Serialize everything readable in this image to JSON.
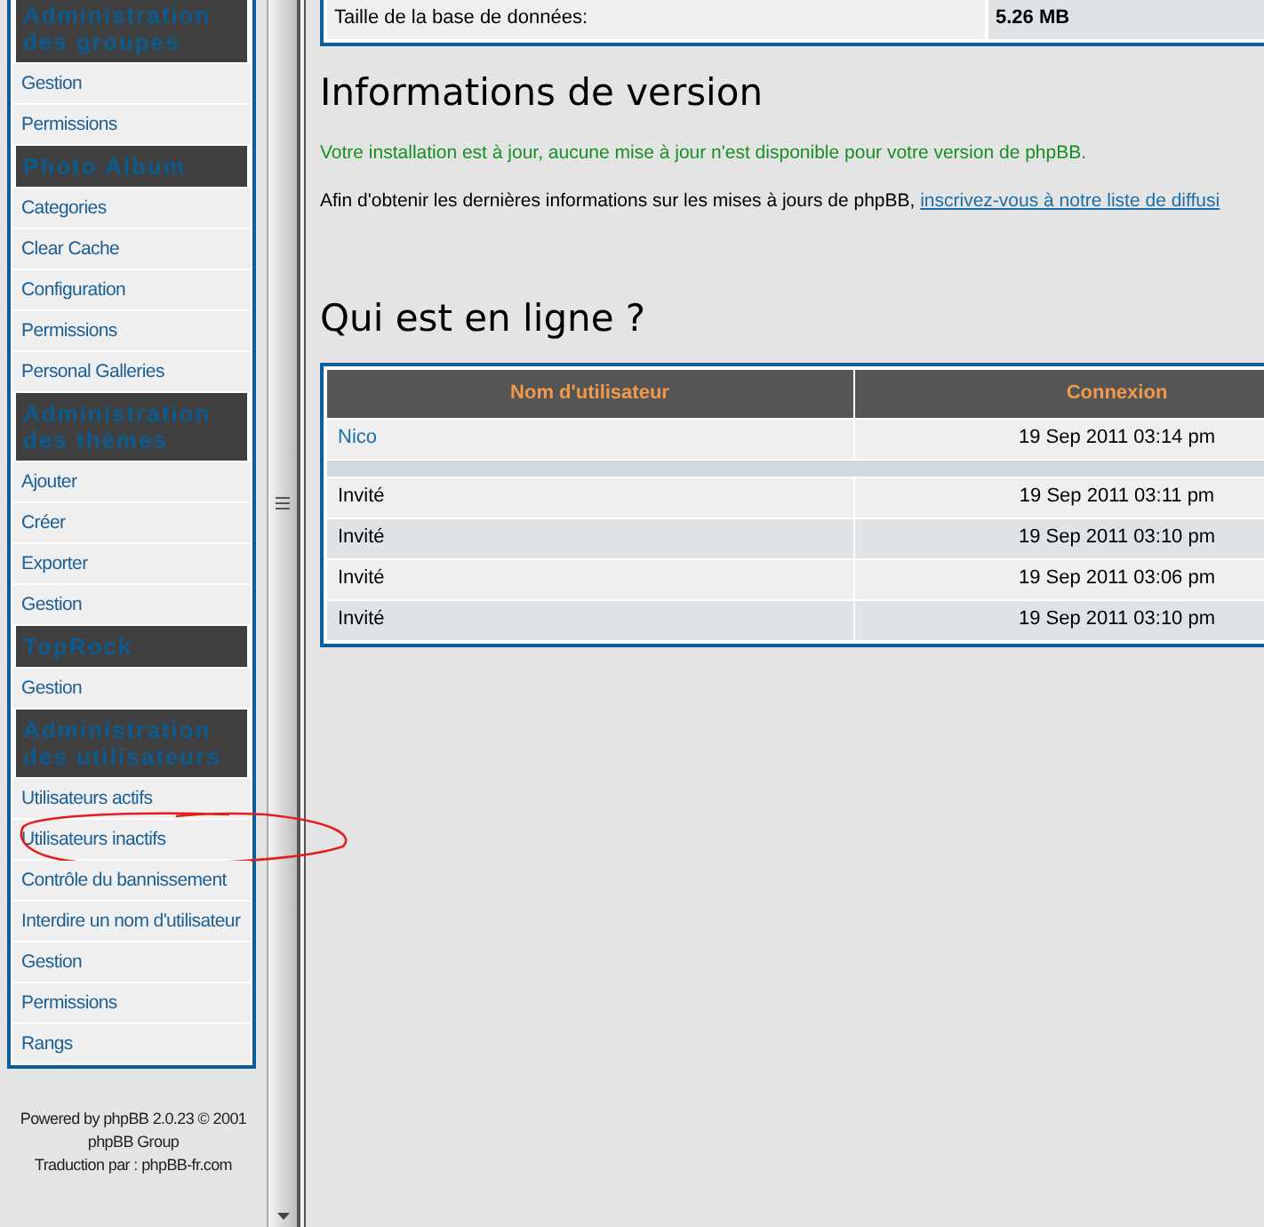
{
  "sidebar": {
    "sections": [
      {
        "title": "Administration des groupes",
        "items": [
          {
            "label": "Gestion",
            "highlighted": false
          },
          {
            "label": "Permissions",
            "highlighted": false
          }
        ]
      },
      {
        "title": "Photo Album",
        "items": [
          {
            "label": "Categories",
            "highlighted": false
          },
          {
            "label": "Clear Cache",
            "highlighted": false
          },
          {
            "label": "Configuration",
            "highlighted": false
          },
          {
            "label": "Permissions",
            "highlighted": false
          },
          {
            "label": "Personal Galleries",
            "highlighted": false
          }
        ]
      },
      {
        "title": "Administration des thèmes",
        "items": [
          {
            "label": "Ajouter",
            "highlighted": false
          },
          {
            "label": "Créer",
            "highlighted": false
          },
          {
            "label": "Exporter",
            "highlighted": false
          },
          {
            "label": "Gestion",
            "highlighted": false
          }
        ]
      },
      {
        "title": "TopRock",
        "items": [
          {
            "label": "Gestion",
            "highlighted": false
          }
        ]
      },
      {
        "title": "Administration des utilisateurs",
        "items": [
          {
            "label": "Utilisateurs actifs",
            "highlighted": false
          },
          {
            "label": "Utilisateurs inactifs",
            "highlighted": true
          },
          {
            "label": "Contrôle du bannissement",
            "highlighted": false
          },
          {
            "label": "Interdire un nom d'utilisateur",
            "highlighted": false
          },
          {
            "label": "Gestion",
            "highlighted": false
          },
          {
            "label": "Permissions",
            "highlighted": false
          },
          {
            "label": "Rangs",
            "highlighted": false
          }
        ]
      }
    ],
    "footer": [
      "Powered by phpBB 2.0.23 © 2001",
      "phpBB Group",
      "Traduction par : phpBB-fr.com"
    ]
  },
  "stats_row": {
    "label": "Taille de la base de données:",
    "value": "5.26 MB"
  },
  "version": {
    "title": "Informations de version",
    "status": "Votre installation est à jour, aucune mise à jour n'est disponible pour votre version de phpBB.",
    "info": "Afin d'obtenir les dernières informations sur les mises à jours de phpBB,",
    "link": "inscrivez-vous à notre liste de diffusi"
  },
  "online": {
    "title": "Qui est en ligne ?",
    "columns": [
      "Nom d'utilisateur",
      "Connexion"
    ],
    "members": [
      {
        "user": "Nico",
        "time": "19 Sep 2011 03:14 pm"
      }
    ],
    "guests": [
      {
        "user": "Invité",
        "time": "19 Sep 2011 03:11 pm"
      },
      {
        "user": "Invité",
        "time": "19 Sep 2011 03:10 pm"
      },
      {
        "user": "Invité",
        "time": "19 Sep 2011 03:06 pm"
      },
      {
        "user": "Invité",
        "time": "19 Sep 2011 03:10 pm"
      }
    ]
  }
}
